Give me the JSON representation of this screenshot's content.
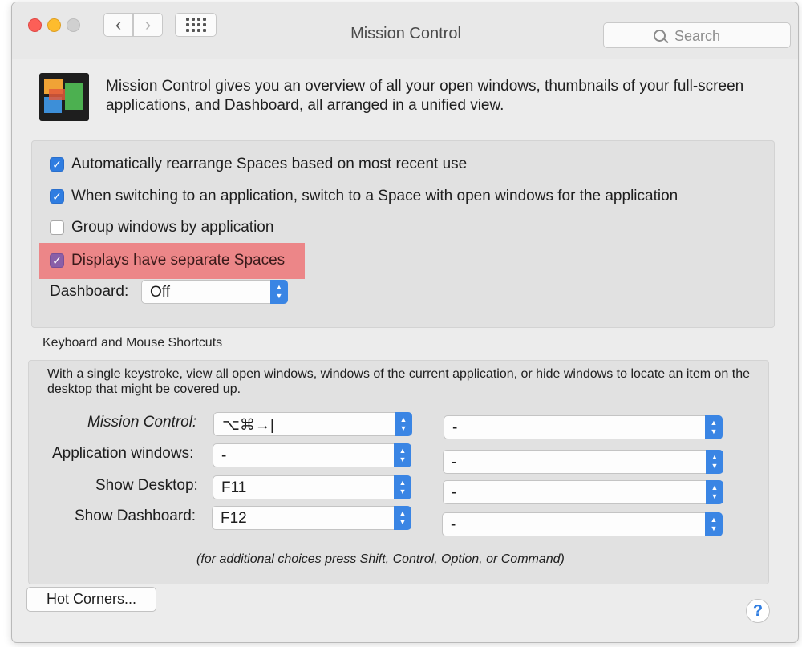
{
  "window": {
    "title": "Mission Control"
  },
  "toolbar": {
    "back_glyph": "‹",
    "forward_glyph": "›",
    "search_placeholder": "Search"
  },
  "intro": {
    "text": "Mission Control gives you an overview of all your open windows, thumbnails of your full-screen applications, and Dashboard, all arranged in a unified view."
  },
  "options": [
    {
      "label": "Automatically rearrange Spaces based on most recent use",
      "checked": true
    },
    {
      "label": "When switching to an application, switch to a Space with open windows for the application",
      "checked": true
    },
    {
      "label": "Group windows by application",
      "checked": false
    },
    {
      "label": "Displays have separate Spaces",
      "checked": true,
      "highlighted": true
    }
  ],
  "dashboard": {
    "label": "Dashboard:",
    "value": "Off"
  },
  "shortcuts": {
    "section_title": "Keyboard and Mouse Shortcuts",
    "description": "With a single keystroke, view all open windows, windows of the current application, or hide windows to locate an item on the desktop that might be covered up.",
    "rows": [
      {
        "label": "Mission Control:",
        "keyboard": "⌥⌘→|",
        "mouse": "-"
      },
      {
        "label": "Application windows:",
        "keyboard": "-",
        "mouse": "-"
      },
      {
        "label": "Show Desktop:",
        "keyboard": "F11",
        "mouse": "-"
      },
      {
        "label": "Show Dashboard:",
        "keyboard": "F12",
        "mouse": "-"
      }
    ],
    "hint": "(for additional choices press Shift, Control, Option, or Command)"
  },
  "buttons": {
    "hot_corners": "Hot Corners...",
    "help": "?"
  },
  "colors": {
    "accent": "#2f7de1",
    "highlight": "#ec8688",
    "checkbox_checked": "#2f7de1"
  }
}
